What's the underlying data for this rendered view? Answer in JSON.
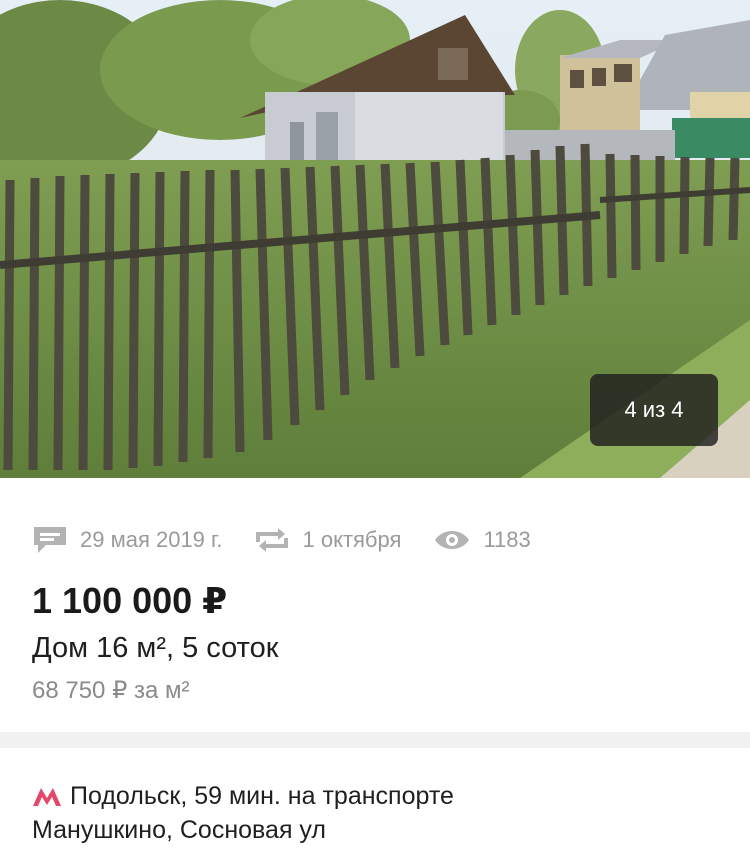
{
  "gallery": {
    "counter": "4 из 4"
  },
  "meta": {
    "published": "29 мая 2019 г.",
    "updated": "1 октября",
    "views": "1183"
  },
  "listing": {
    "price": "1 100 000 ₽",
    "summary": "Дом 16 м², 5 соток",
    "price_per_m2": "68 750 ₽ за м²"
  },
  "location": {
    "transport": "Подольск, 59 мин. на транспорте",
    "address": "Манушкино, Сосновая ул"
  },
  "colors": {
    "metro": "#e3486a",
    "meta_text": "#9a9a9a"
  },
  "icons": [
    "comment-icon",
    "refresh-icon",
    "eye-icon",
    "metro-icon"
  ]
}
